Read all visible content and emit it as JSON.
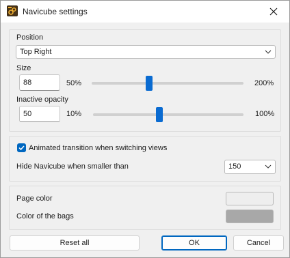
{
  "window": {
    "title": "Navicube settings"
  },
  "position": {
    "label": "Position",
    "value": "Top Right"
  },
  "size": {
    "label": "Size",
    "value": "88",
    "min_label": "50%",
    "max_label": "200%",
    "slider_fraction": 0.38
  },
  "opacity": {
    "label": "Inactive opacity",
    "value": "50",
    "min_label": "10%",
    "max_label": "100%",
    "slider_fraction": 0.44
  },
  "animated": {
    "label": "Animated transition when switching views",
    "checked": true
  },
  "hide": {
    "label": "Hide Navicube when smaller than",
    "value": "150"
  },
  "colors": {
    "page_label": "Page color",
    "page_color": "#eeeeee",
    "bags_label": "Color of the bags",
    "bags_color": "#a8a8a8"
  },
  "buttons": {
    "reset": "Reset all",
    "ok": "OK",
    "cancel": "Cancel"
  },
  "icons": {
    "app": "navicube-app-icon",
    "close": "close-icon",
    "dropdown": "chevron-down-icon",
    "check": "checkmark-icon"
  }
}
